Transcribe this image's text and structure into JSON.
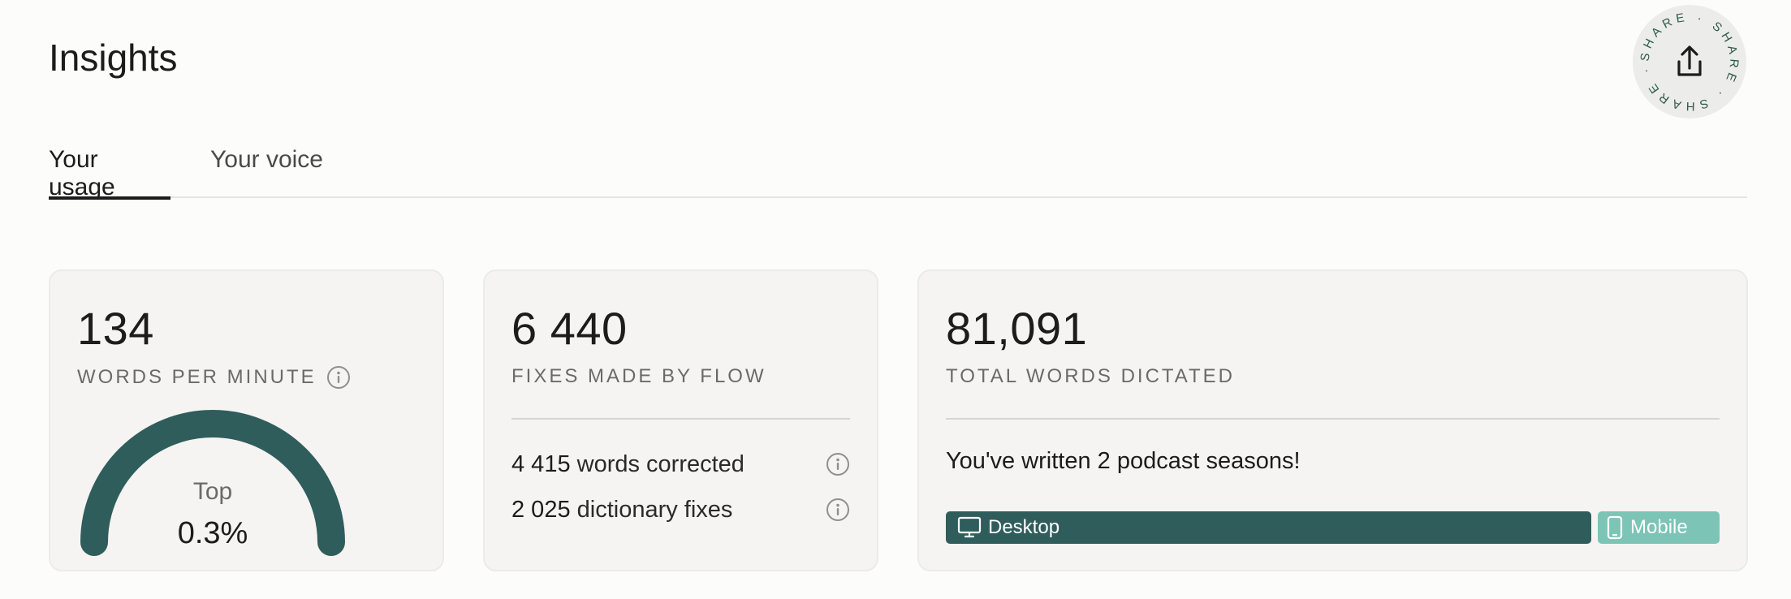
{
  "page": {
    "title": "Insights"
  },
  "share": {
    "ring_text": "SHARE · SHARE · SHARE · ",
    "icon": "upload-share-icon"
  },
  "tabs": [
    {
      "label": "Your usage",
      "active": true
    },
    {
      "label": "Your voice",
      "active": false
    }
  ],
  "cards": {
    "wpm": {
      "value": "134",
      "label": "WORDS PER MINUTE",
      "gauge": {
        "caption_top": "Top",
        "caption_value": "0.3%",
        "fill_fraction": 1.0
      }
    },
    "fixes": {
      "value": "6 440",
      "label": "FIXES MADE BY FLOW",
      "rows": [
        {
          "num": "4 415",
          "text": " words corrected"
        },
        {
          "num": "2 025",
          "text": " dictionary fixes"
        }
      ]
    },
    "dictated": {
      "value": "81,091",
      "label": "TOTAL WORDS DICTATED",
      "message": "You've written 2 podcast seasons!",
      "split": [
        {
          "label": "Desktop",
          "icon": "desktop-icon"
        },
        {
          "label": "Mobile",
          "icon": "mobile-icon"
        }
      ]
    }
  },
  "colors": {
    "accent_dark": "#2f5d5b",
    "accent_light": "#7cc4b6",
    "share_text": "#2d5a4f"
  }
}
